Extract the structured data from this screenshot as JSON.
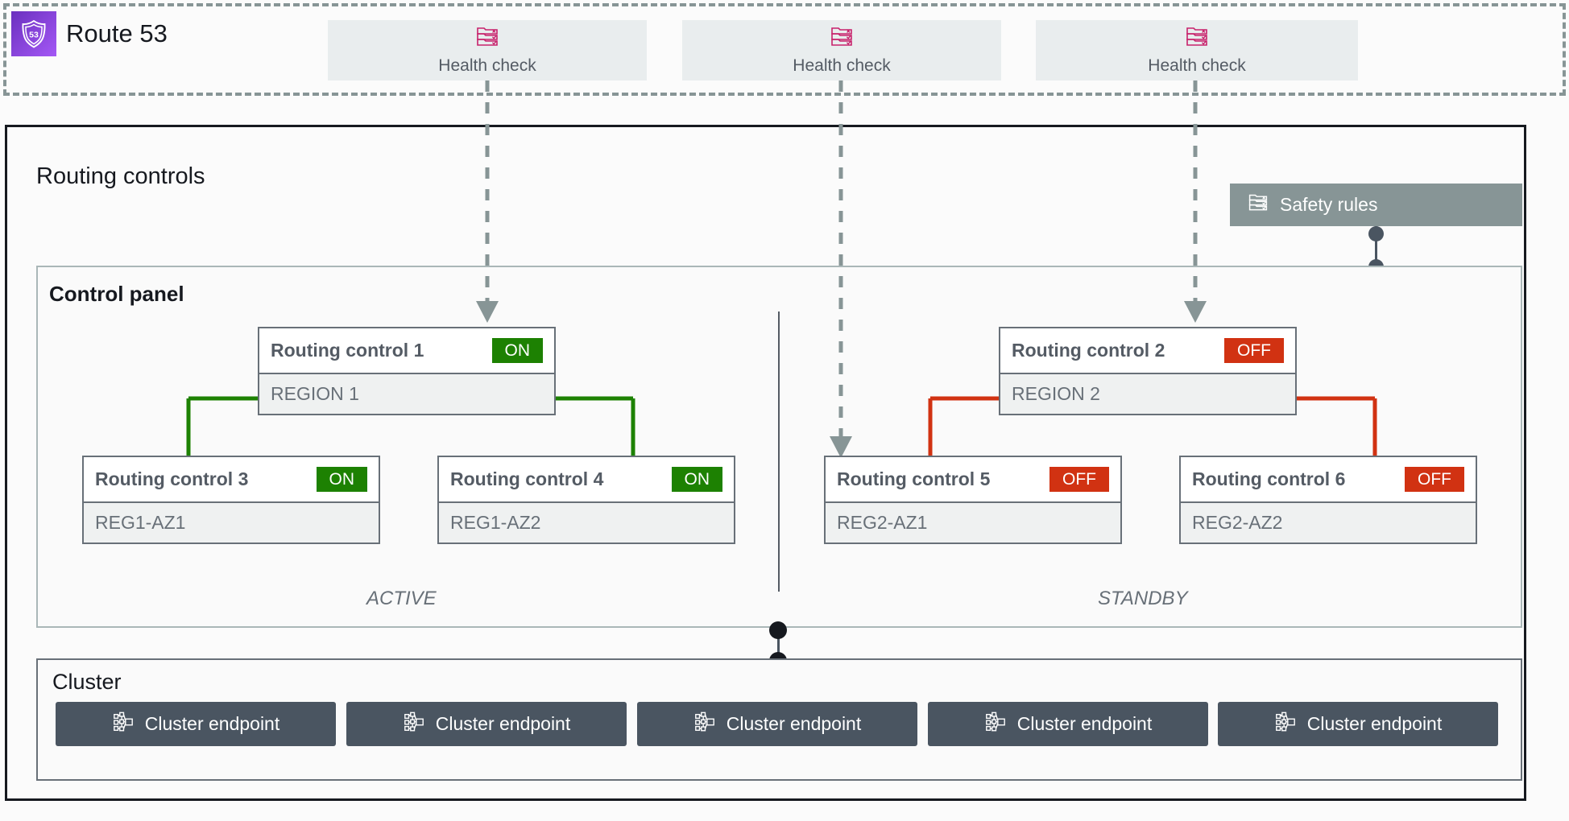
{
  "route53": {
    "title": "Route 53",
    "logo_icon": "route53-shield-icon",
    "logo_text": "53",
    "health_checks": [
      {
        "label": "Health check",
        "icon": "health-check-icon"
      },
      {
        "label": "Health check",
        "icon": "health-check-icon"
      },
      {
        "label": "Health check",
        "icon": "health-check-icon"
      }
    ]
  },
  "routing_controls": {
    "title": "Routing controls",
    "safety_rules": {
      "label": "Safety rules",
      "icon": "safety-rules-icon"
    },
    "control_panel": {
      "title": "Control panel",
      "mode_labels": {
        "left": "ACTIVE",
        "right": "STANDBY"
      },
      "controls": [
        {
          "name": "Routing control 1",
          "state": "ON",
          "region": "REGION 1"
        },
        {
          "name": "Routing control 2",
          "state": "OFF",
          "region": "REGION 2"
        },
        {
          "name": "Routing control 3",
          "state": "ON",
          "region": "REG1-AZ1"
        },
        {
          "name": "Routing control 4",
          "state": "ON",
          "region": "REG1-AZ2"
        },
        {
          "name": "Routing control 5",
          "state": "OFF",
          "region": "REG2-AZ1"
        },
        {
          "name": "Routing control 6",
          "state": "OFF",
          "region": "REG2-AZ2"
        }
      ]
    }
  },
  "cluster": {
    "title": "Cluster",
    "endpoints": [
      {
        "label": "Cluster endpoint",
        "icon": "cluster-endpoint-icon"
      },
      {
        "label": "Cluster endpoint",
        "icon": "cluster-endpoint-icon"
      },
      {
        "label": "Cluster endpoint",
        "icon": "cluster-endpoint-icon"
      },
      {
        "label": "Cluster endpoint",
        "icon": "cluster-endpoint-icon"
      },
      {
        "label": "Cluster endpoint",
        "icon": "cluster-endpoint-icon"
      }
    ]
  },
  "colors": {
    "on_green": "#1d8102",
    "off_red": "#d13212",
    "route53_purple": "#8c4fff",
    "health_check_pink": "#c7216b",
    "safety_rules_gray": "#879596",
    "cluster_endpoint_gray": "#4a5561",
    "dashed_boundary": "#879596"
  }
}
